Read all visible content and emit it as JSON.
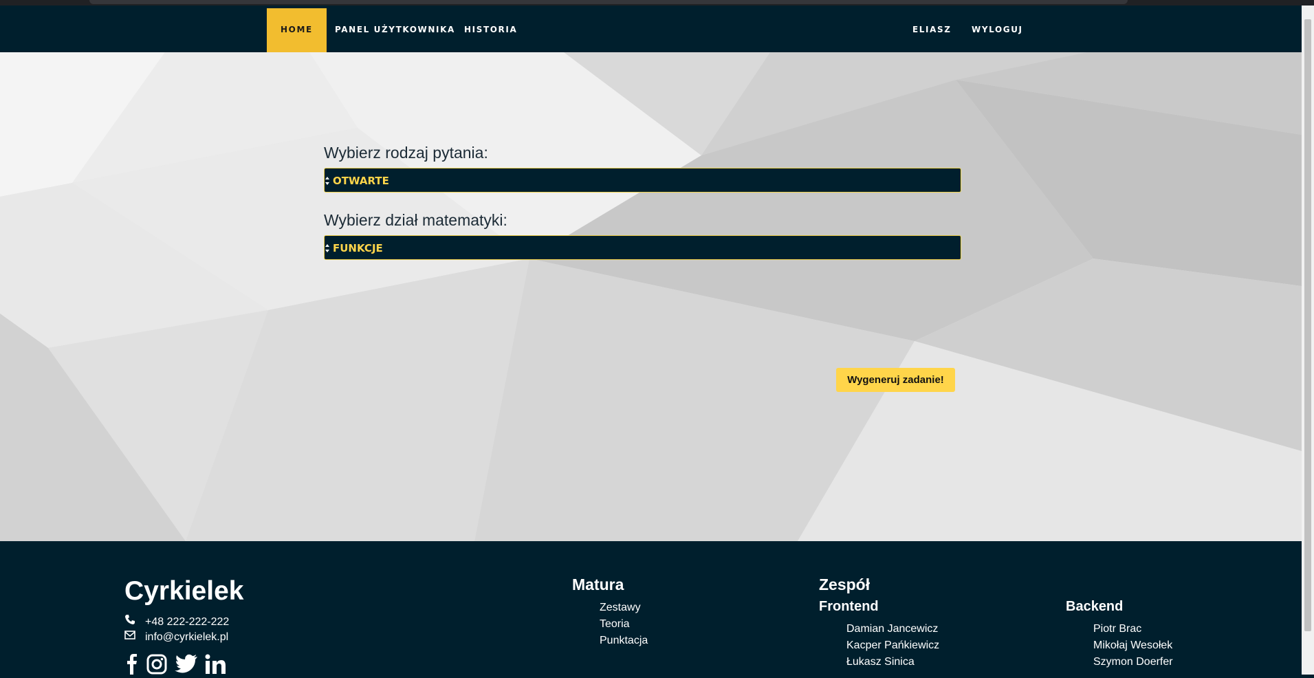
{
  "nav": {
    "items": [
      "HOME",
      "PANEL UŻYTKOWNIKA",
      "HISTORIA"
    ],
    "right": [
      "ELIASZ",
      "WYLOGUJ"
    ],
    "active_color": "#f2bd2f"
  },
  "form": {
    "type_label": "Wybierz rodzaj pytania:",
    "type_value": "OTWARTE",
    "section_label": "Wybierz dział matematyki:",
    "section_value": "FUNKCJE",
    "submit": "Wygeneruj zadanie!"
  },
  "footer": {
    "brand": "Cyrkielek",
    "phone": "+48 222-222-222",
    "email": "info@cyrkielek.pl",
    "social": [
      "facebook-icon",
      "instagram-icon",
      "twitter-icon",
      "linkedin-icon"
    ],
    "matura": {
      "title": "Matura",
      "links": [
        "Zestawy",
        "Teoria",
        "Punktacja"
      ]
    },
    "team": {
      "title": "Zespół",
      "frontend": {
        "title": "Frontend",
        "members": [
          "Damian Jancewicz",
          "Kacper Pańkiewicz",
          "Łukasz Sinica"
        ]
      },
      "backend": {
        "title": "Backend",
        "members": [
          "Piotr Brac",
          "Mikołaj Wesołek",
          "Szymon Doerfer"
        ]
      }
    }
  },
  "colors": {
    "navy": "#001f2d",
    "accent": "#ffd54a"
  }
}
